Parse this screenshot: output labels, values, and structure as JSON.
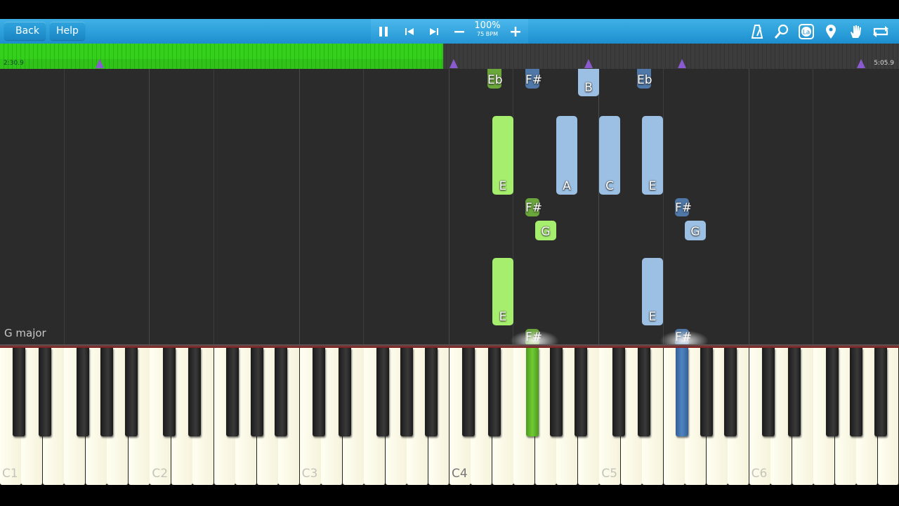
{
  "toolbar": {
    "back_label": "Back",
    "help_label": "Help",
    "tempo_percent": "100%",
    "tempo_bpm": "75 BPM",
    "icons": [
      "pause-icon",
      "skip-back-icon",
      "skip-forward-icon",
      "minus-icon",
      "plus-icon",
      "metronome-icon",
      "magnifier-icon",
      "note-labels-icon",
      "location-pin-icon",
      "hand-icon",
      "loop-icon"
    ]
  },
  "timeline": {
    "start_time": "2:30.9",
    "end_time": "5:05.9",
    "progress_fraction": 0.493
  },
  "key_signature": "G major",
  "notes": [
    {
      "label": "Eb",
      "color": "dgreen"
    },
    {
      "label": "F#",
      "color": "dblue"
    },
    {
      "label": "B",
      "color": "blue"
    },
    {
      "label": "Eb",
      "color": "dblue"
    },
    {
      "label": "E",
      "color": "green"
    },
    {
      "label": "A",
      "color": "blue"
    },
    {
      "label": "C",
      "color": "blue"
    },
    {
      "label": "E",
      "color": "blue"
    },
    {
      "label": "F#",
      "color": "dgreen"
    },
    {
      "label": "F#",
      "color": "dblue"
    },
    {
      "label": "G",
      "color": "green"
    },
    {
      "label": "G",
      "color": "blue"
    },
    {
      "label": "E",
      "color": "green"
    },
    {
      "label": "E",
      "color": "blue"
    },
    {
      "label": "F#",
      "color": "dgreen"
    },
    {
      "label": "F#",
      "color": "dblue"
    }
  ],
  "keyboard": {
    "octave_labels": [
      "C1",
      "C2",
      "C3",
      "C4",
      "C5",
      "C6"
    ],
    "pressed_keys": [
      {
        "note": "F#4",
        "hand": "green"
      },
      {
        "note": "F#5",
        "hand": "blue"
      }
    ]
  },
  "colors": {
    "toolbar": "#2a9ed9",
    "progress": "#34d11c",
    "right_hand_note": "#a6ee6e",
    "left_hand_note": "#9cc0e4",
    "marker": "#8a5ad0"
  }
}
